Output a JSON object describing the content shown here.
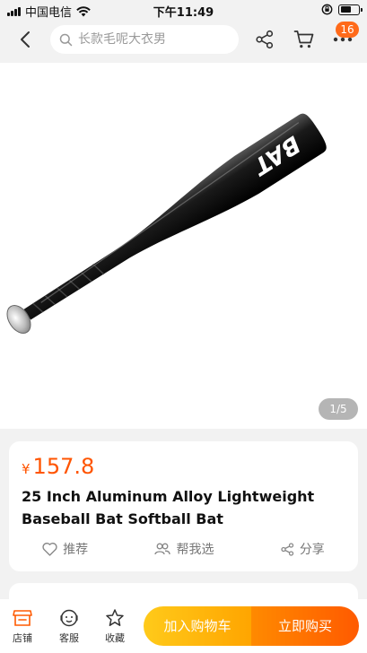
{
  "status_bar": {
    "carrier": "中国电信",
    "time": "下午11:49"
  },
  "nav": {
    "search_placeholder": "长款毛呢大衣男",
    "cart_badge": "16"
  },
  "gallery": {
    "pager": "1/5",
    "bat_text": "BAT"
  },
  "product": {
    "currency": "¥",
    "price": "157.8",
    "title": "25 Inch Aluminum Alloy Lightweight Baseball Bat Softball Bat",
    "actions": {
      "recommend": "推荐",
      "help_choose": "帮我选",
      "share": "分享"
    }
  },
  "bottom_bar": {
    "store": "店铺",
    "service": "客服",
    "favorite": "收藏",
    "add_to_cart": "加入购物车",
    "buy_now": "立即购买"
  },
  "colors": {
    "accent": "#ff5400",
    "cart_button": "#ffb300",
    "buy_button": "#ff6a00",
    "store_icon": "#ff5a00"
  }
}
